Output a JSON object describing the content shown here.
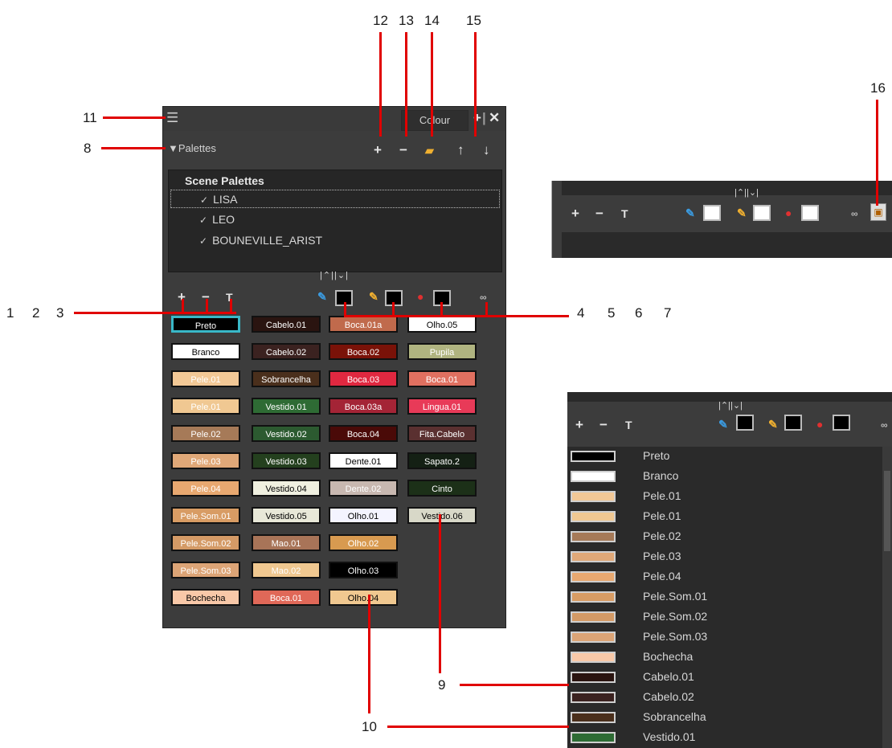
{
  "callouts": {
    "n1": "1",
    "n2": "2",
    "n3": "3",
    "n4": "4",
    "n5": "5",
    "n6": "6",
    "n7": "7",
    "n8": "8",
    "n9": "9",
    "n10": "10",
    "n11": "11",
    "n12": "12",
    "n13": "13",
    "n14": "14",
    "n15": "15",
    "n16": "16",
    "n9b": "9"
  },
  "panel": {
    "tab_label": "Colour",
    "palettes_header": "Palettes",
    "scene_palettes_title": "Scene Palettes",
    "palettes": [
      "LISA",
      "LEO",
      "BOUNEVILLE_ARIST"
    ],
    "splitter": "|⌃||⌄|"
  },
  "icons": {
    "menu": "menu-icon",
    "add": "plus-icon",
    "remove": "minus-icon",
    "import": "folder-icon",
    "move_up": "arrow-up-icon",
    "move_down": "arrow-down-icon",
    "rename": "rename-icon",
    "pencil": "pencil-icon",
    "brush": "brush-icon",
    "paint": "paint-icon",
    "link": "link-icon"
  },
  "swatches": [
    {
      "label": "Preto",
      "bg": "#000000",
      "fg": "#ffffff"
    },
    {
      "label": "Cabelo.01",
      "bg": "#2a1410",
      "fg": "#ffffff"
    },
    {
      "label": "Boca.01a",
      "bg": "#c06a4c",
      "fg": "#ffffff"
    },
    {
      "label": "Olho.05",
      "bg": "#ffffff",
      "fg": "#000000"
    },
    {
      "label": "Branco",
      "bg": "#ffffff",
      "fg": "#000000"
    },
    {
      "label": "Cabelo.02",
      "bg": "#3b2220",
      "fg": "#ffffff"
    },
    {
      "label": "Boca.02",
      "bg": "#7a1208",
      "fg": "#ffffff"
    },
    {
      "label": "Pupila",
      "bg": "#b0b480",
      "fg": "#ffffff"
    },
    {
      "label": "Pele.01",
      "bg": "#f2c896",
      "fg": "#ffffff"
    },
    {
      "label": "Sobrancelha",
      "bg": "#4a2f1c",
      "fg": "#ffffff"
    },
    {
      "label": "Boca.03",
      "bg": "#e02840",
      "fg": "#ffffff"
    },
    {
      "label": "Boca.01",
      "bg": "#e07060",
      "fg": "#ffffff"
    },
    {
      "label": "Pele.01",
      "bg": "#f0c892",
      "fg": "#ffffff"
    },
    {
      "label": "Vestido.01",
      "bg": "#2e6b34",
      "fg": "#ffffff"
    },
    {
      "label": "Boca.03a",
      "bg": "#a42436",
      "fg": "#ffffff"
    },
    {
      "label": "Lingua.01",
      "bg": "#e83a58",
      "fg": "#ffffff"
    },
    {
      "label": "Pele.02",
      "bg": "#a67a58",
      "fg": "#ffffff"
    },
    {
      "label": "Vestido.02",
      "bg": "#2c5a30",
      "fg": "#ffffff"
    },
    {
      "label": "Boca.04",
      "bg": "#4a0a08",
      "fg": "#ffffff"
    },
    {
      "label": "Fita.Cabelo",
      "bg": "#5a3030",
      "fg": "#ffffff"
    },
    {
      "label": "Pele.03",
      "bg": "#e0a878",
      "fg": "#ffffff"
    },
    {
      "label": "Vestido.03",
      "bg": "#24401e",
      "fg": "#ffffff"
    },
    {
      "label": "Dente.01",
      "bg": "#ffffff",
      "fg": "#000000"
    },
    {
      "label": "Sapato.2",
      "bg": "#142014",
      "fg": "#ffffff"
    },
    {
      "label": "Pele.04",
      "bg": "#e8a870",
      "fg": "#ffffff"
    },
    {
      "label": "Vestido.04",
      "bg": "#f0f0e0",
      "fg": "#000000"
    },
    {
      "label": "Dente.02",
      "bg": "#c8b8b0",
      "fg": "#ffffff"
    },
    {
      "label": "Cinto",
      "bg": "#1c3018",
      "fg": "#ffffff"
    },
    {
      "label": "Pele.Som.01",
      "bg": "#d89c64",
      "fg": "#ffffff"
    },
    {
      "label": "Vestido.05",
      "bg": "#e8e8d8",
      "fg": "#000000"
    },
    {
      "label": "Olho.01",
      "bg": "#f4f4ff",
      "fg": "#000000"
    },
    {
      "label": "Vestido.06",
      "bg": "#d8d8c8",
      "fg": "#000000"
    },
    {
      "label": "Pele.Som.02",
      "bg": "#d49a66",
      "fg": "#ffffff"
    },
    {
      "label": "Mao.01",
      "bg": "#a87458",
      "fg": "#ffffff"
    },
    {
      "label": "Olho.02",
      "bg": "#d89a50",
      "fg": "#ffffff"
    },
    {
      "label": "Pele.Som.03",
      "bg": "#dca476",
      "fg": "#ffffff"
    },
    {
      "label": "Mao.02",
      "bg": "#f0c890",
      "fg": "#ffffff"
    },
    {
      "label": "Olho.03",
      "bg": "#000000",
      "fg": "#ffffff"
    },
    {
      "label": "Bochecha",
      "bg": "#f8c8a8",
      "fg": "#000000"
    },
    {
      "label": "Boca.01",
      "bg": "#e06858",
      "fg": "#ffffff"
    },
    {
      "label": "Olho.04",
      "bg": "#f0c890",
      "fg": "#000000"
    }
  ],
  "list": [
    {
      "label": "Preto",
      "bg": "#000000"
    },
    {
      "label": "Branco",
      "bg": "#ffffff"
    },
    {
      "label": "Pele.01",
      "bg": "#f2c896"
    },
    {
      "label": "Pele.01",
      "bg": "#f0c892"
    },
    {
      "label": "Pele.02",
      "bg": "#a67a58"
    },
    {
      "label": "Pele.03",
      "bg": "#e0a878"
    },
    {
      "label": "Pele.04",
      "bg": "#e8a870"
    },
    {
      "label": "Pele.Som.01",
      "bg": "#d89c64"
    },
    {
      "label": "Pele.Som.02",
      "bg": "#d49a66"
    },
    {
      "label": "Pele.Som.03",
      "bg": "#dca476"
    },
    {
      "label": "Bochecha",
      "bg": "#f8c8a8"
    },
    {
      "label": "Cabelo.01",
      "bg": "#2a1410"
    },
    {
      "label": "Cabelo.02",
      "bg": "#3b2220"
    },
    {
      "label": "Sobrancelha",
      "bg": "#4a2f1c"
    },
    {
      "label": "Vestido.01",
      "bg": "#2e6b34"
    }
  ]
}
